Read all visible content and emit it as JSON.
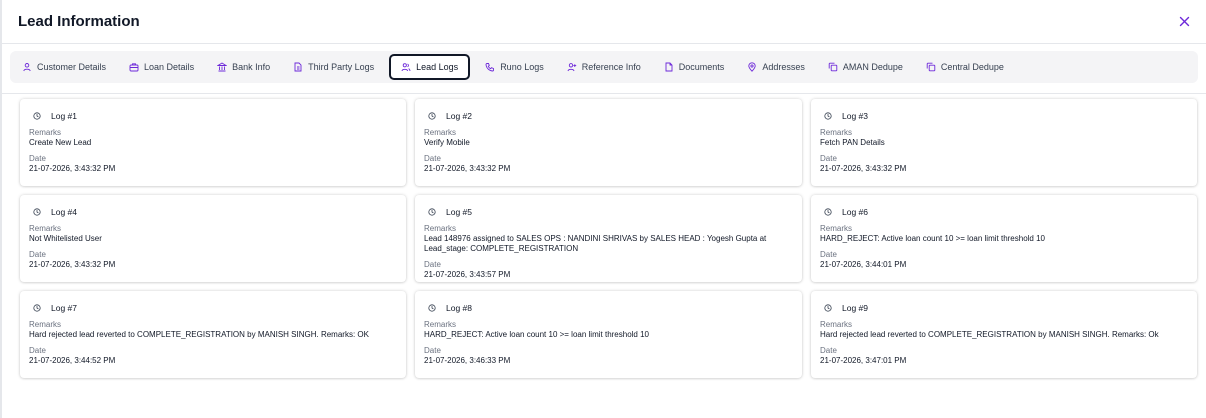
{
  "header": {
    "title": "Lead Information"
  },
  "tabs": [
    {
      "label": "Customer Details",
      "icon": "user-icon"
    },
    {
      "label": "Loan Details",
      "icon": "briefcase-icon"
    },
    {
      "label": "Bank Info",
      "icon": "bank-icon"
    },
    {
      "label": "Third Party Logs",
      "icon": "file-icon"
    },
    {
      "label": "Lead Logs",
      "icon": "users-icon",
      "active": true
    },
    {
      "label": "Runo Logs",
      "icon": "phone-icon"
    },
    {
      "label": "Reference Info",
      "icon": "user-plus-icon"
    },
    {
      "label": "Documents",
      "icon": "document-icon"
    },
    {
      "label": "Addresses",
      "icon": "map-pin-icon"
    },
    {
      "label": "AMAN Dedupe",
      "icon": "copy-icon"
    },
    {
      "label": "Central Dedupe",
      "icon": "copy-icon"
    }
  ],
  "labels": {
    "remarks": "Remarks",
    "date": "Date"
  },
  "logs": [
    {
      "title": "Log #1",
      "remarks": "Create New Lead",
      "date": "21-07-2026, 3:43:32 PM"
    },
    {
      "title": "Log #2",
      "remarks": "Verify Mobile",
      "date": "21-07-2026, 3:43:32 PM"
    },
    {
      "title": "Log #3",
      "remarks": "Fetch PAN Details",
      "date": "21-07-2026, 3:43:32 PM"
    },
    {
      "title": "Log #4",
      "remarks": "Not Whitelisted User",
      "date": "21-07-2026, 3:43:32 PM"
    },
    {
      "title": "Log #5",
      "remarks": "Lead 148976 assigned to SALES OPS : NANDINI SHRIVAS by SALES HEAD : Yogesh Gupta at Lead_stage: COMPLETE_REGISTRATION",
      "date": "21-07-2026, 3:43:57 PM"
    },
    {
      "title": "Log #6",
      "remarks": "HARD_REJECT: Active loan count 10 >= loan limit threshold 10",
      "date": "21-07-2026, 3:44:01 PM"
    },
    {
      "title": "Log #7",
      "remarks": "Hard rejected lead reverted to COMPLETE_REGISTRATION by MANISH SINGH. Remarks: OK",
      "date": "21-07-2026, 3:44:52 PM"
    },
    {
      "title": "Log #8",
      "remarks": "HARD_REJECT: Active loan count 10 >= loan limit threshold 10",
      "date": "21-07-2026, 3:46:33 PM"
    },
    {
      "title": "Log #9",
      "remarks": "Hard rejected lead reverted to COMPLETE_REGISTRATION by MANISH SINGH. Remarks: Ok",
      "date": "21-07-2026, 3:47:01 PM"
    }
  ]
}
